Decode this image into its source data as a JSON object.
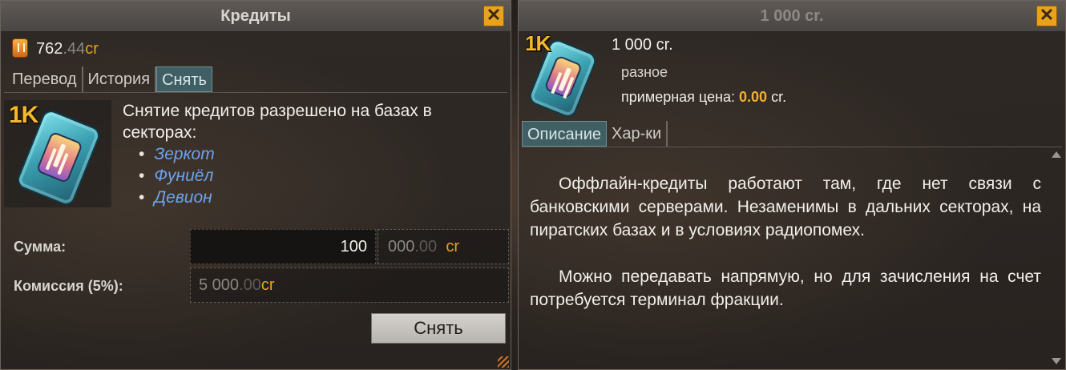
{
  "left_window": {
    "title": "Кредиты",
    "close_icon": "close-x",
    "balance": {
      "icon": "credit-coin-icon",
      "main": "762",
      "decimals": ".44",
      "currency": "cr"
    },
    "tabs": [
      {
        "label": "Перевод",
        "active": false
      },
      {
        "label": "История",
        "active": false
      },
      {
        "label": "Снять",
        "active": true
      }
    ],
    "item_badge": "1K",
    "info_text": "Снятие кредитов разрешено на базах в секторах:",
    "sectors": [
      "Зеркот",
      "Фуниёл",
      "Девион"
    ],
    "amount_label": "Сумма:",
    "amount_value": "100",
    "amount_suffix": {
      "main": "000",
      "decimals": ".00",
      "currency": "cr"
    },
    "commission_label": "Комиссия (5%):",
    "commission_value": {
      "main": "5 000",
      "decimals": ".00",
      "currency": "cr"
    },
    "withdraw_button": "Снять"
  },
  "right_window": {
    "title": "1 000 cr.",
    "close_icon": "close-x",
    "item_badge": "1K",
    "item_name": "1 000 cr.",
    "category": "разное",
    "price_label": "примерная цена:",
    "price_value": "0.00",
    "price_currency": "cr.",
    "tabs": [
      {
        "label": "Описание",
        "active": true
      },
      {
        "label": "Хар-ки",
        "active": false
      }
    ],
    "description": [
      "Оффлайн-кредиты работают там, где нет связи с банковскими серверами. Незаменимы в дальних секторах, на пиратских базах и в условиях радиопомех.",
      "Можно передавать напрямую, но для зачисления на счет потребуется терминал фракции."
    ]
  },
  "colors": {
    "accent": "#e8a21c",
    "tab_active": "#3f5f64",
    "link": "#6ea3ee",
    "price": "#f0b030"
  }
}
